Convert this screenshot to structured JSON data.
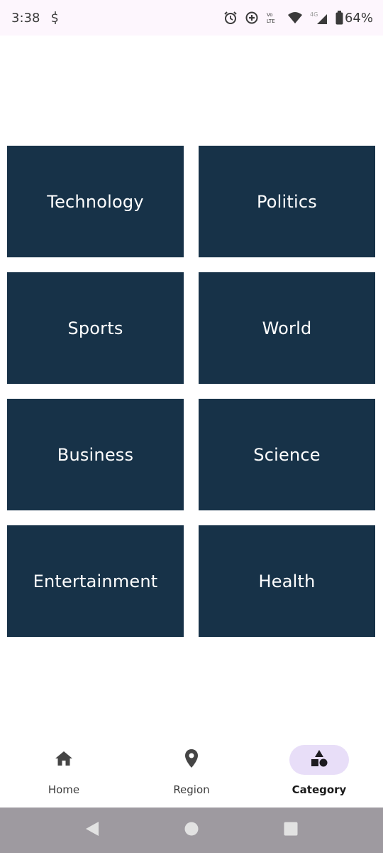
{
  "status_bar": {
    "time": "3:38",
    "battery": "64%",
    "network": "4G",
    "icons": [
      "notification-s-icon",
      "alarm-icon",
      "data-saver-icon",
      "volte-icon",
      "wifi-icon",
      "signal-icon",
      "battery-icon"
    ]
  },
  "categories": [
    {
      "label": "Technology"
    },
    {
      "label": "Politics"
    },
    {
      "label": "Sports"
    },
    {
      "label": "World"
    },
    {
      "label": "Business"
    },
    {
      "label": "Science"
    },
    {
      "label": "Entertainment"
    },
    {
      "label": "Health"
    }
  ],
  "bottom_nav": {
    "items": [
      {
        "label": "Home",
        "icon": "home-icon",
        "active": false
      },
      {
        "label": "Region",
        "icon": "location-pin-icon",
        "active": false
      },
      {
        "label": "Category",
        "icon": "shapes-icon",
        "active": true
      }
    ]
  },
  "colors": {
    "tile_bg": "#173248",
    "active_pill": "#e8def8",
    "system_nav_bg": "#9e9aa0"
  }
}
